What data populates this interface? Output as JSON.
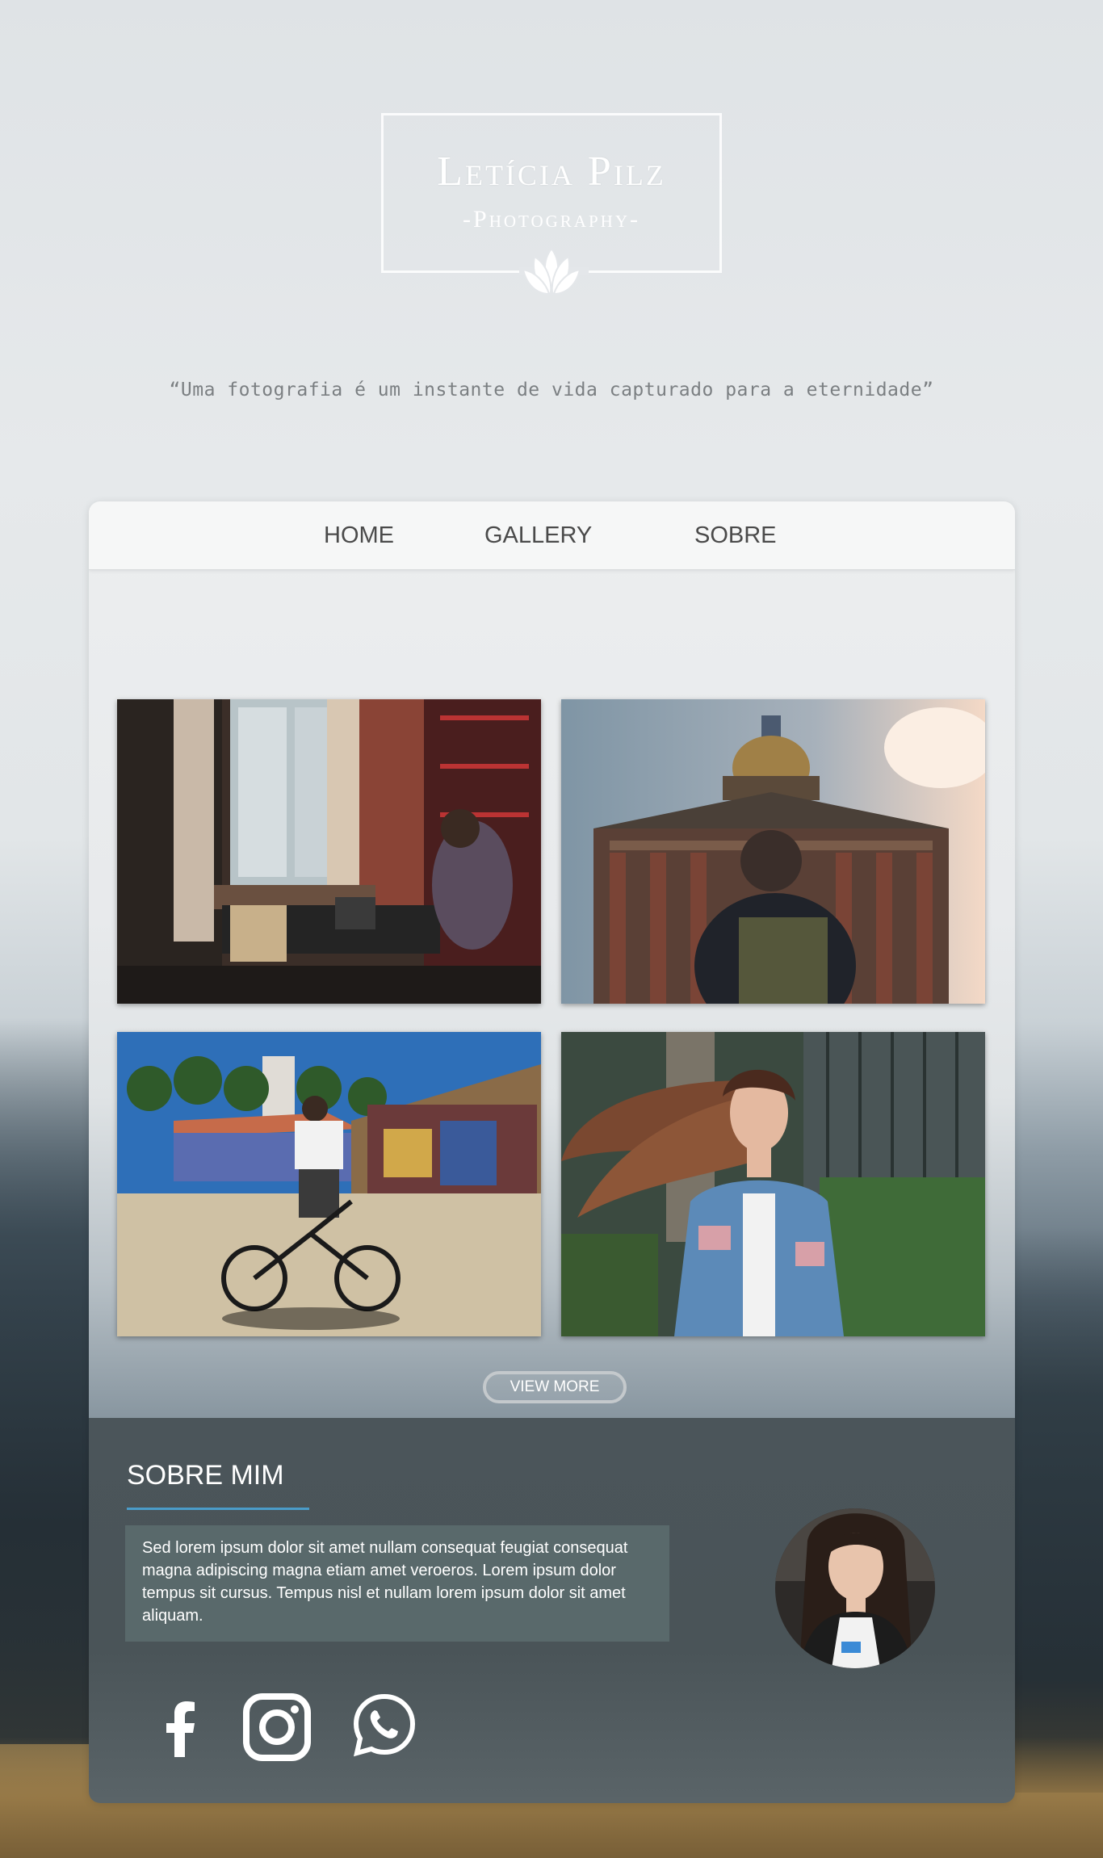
{
  "brand": {
    "title": "Letícia Pilz",
    "subtitle": "-Photography-",
    "logo_icon": "lotus-icon"
  },
  "quote": "“Uma fotografia é um instante de vida capturado para a eternidade”",
  "nav": {
    "items": [
      {
        "label": "HOME"
      },
      {
        "label": "GALLERY"
      },
      {
        "label": "SOBRE"
      }
    ]
  },
  "gallery": {
    "photos": [
      {
        "name": "woman-laptop-cafe-photo"
      },
      {
        "name": "cathedral-backpacker-photo"
      },
      {
        "name": "bmx-rider-graffiti-photo"
      },
      {
        "name": "woman-flowing-hair-photo"
      }
    ],
    "view_more_label": "VIEW MORE"
  },
  "about": {
    "title": "SOBRE MIM",
    "text": "Sed lorem ipsum dolor sit amet nullam consequat feugiat consequat magna adipiscing magna etiam amet veroeros. Lorem ipsum dolor tempus sit cursus. Tempus nisl et nullam lorem ipsum dolor sit amet  aliquam.",
    "accent_color": "#4a9cc9"
  },
  "social": [
    {
      "icon": "facebook-icon"
    },
    {
      "icon": "instagram-icon"
    },
    {
      "icon": "whatsapp-icon"
    }
  ]
}
